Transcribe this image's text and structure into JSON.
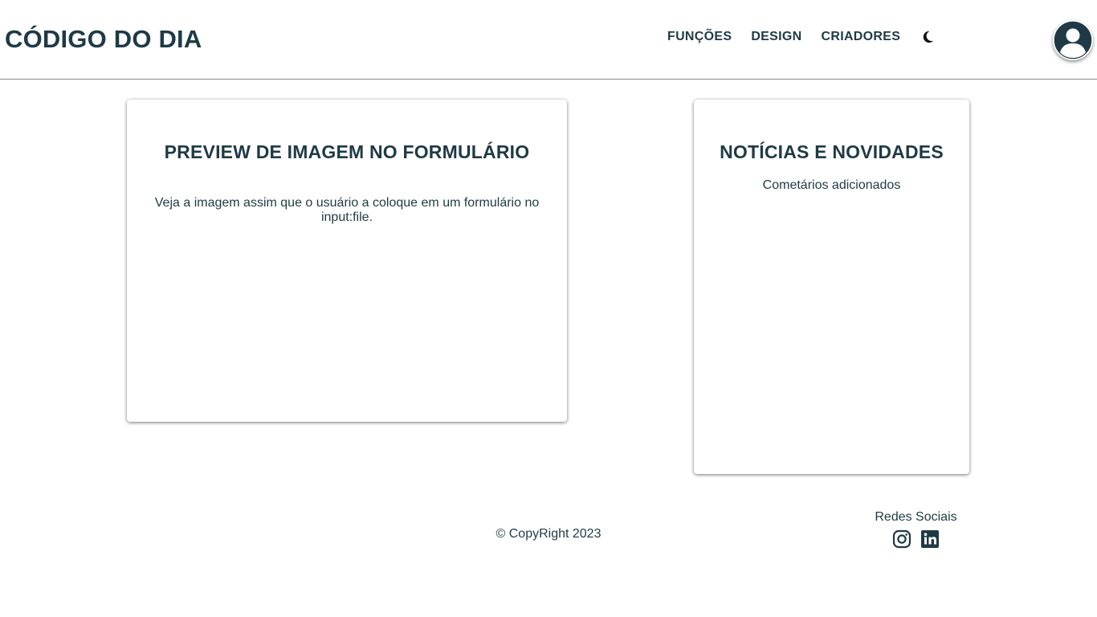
{
  "header": {
    "logo": "CÓDIGO DO DIA",
    "nav": [
      "FUNÇÕES",
      "DESIGN",
      "CRIADORES"
    ],
    "theme_icon": "moon-icon",
    "avatar_icon": "user-avatar-icon"
  },
  "cards": [
    {
      "title": "PREVIEW DE IMAGEM NO FORMULÁRIO",
      "text": "Veja a imagem assim que o usuário a coloque em um formulário no input:file."
    },
    {
      "title": "NOTÍCIAS E NOVIDADES",
      "text": "Cometários adicionados"
    }
  ],
  "footer": {
    "copyright": "© CopyRight 2023",
    "social_title": "Redes Sociais",
    "social_icons": [
      "instagram-icon",
      "linkedin-icon"
    ]
  },
  "colors": {
    "primary": "#1f3a46",
    "background": "#ffffff"
  }
}
